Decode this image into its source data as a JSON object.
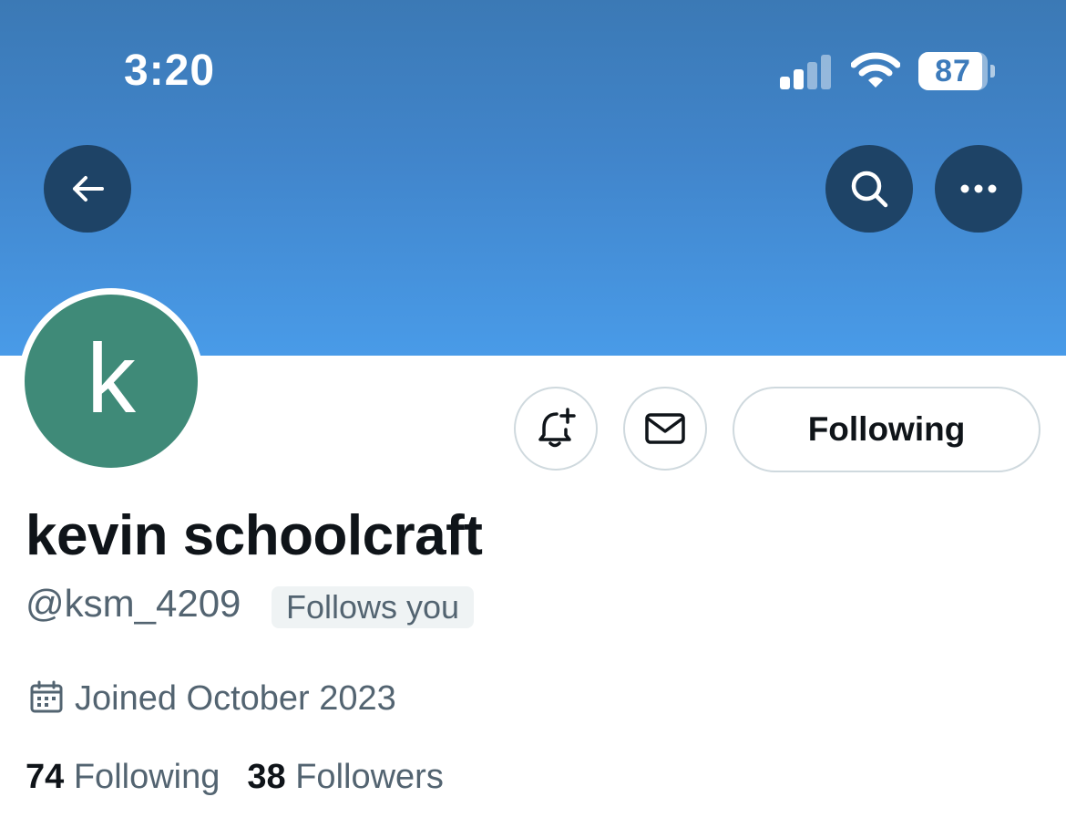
{
  "status_bar": {
    "time": "3:20",
    "battery_percent": "87",
    "signal_bars_active": 2,
    "signal_bars_total": 4
  },
  "header": {
    "banner_color": "#4185cb",
    "back_icon": "arrow-left-icon",
    "search_icon": "search-icon",
    "more_icon": "more-horizontal-icon"
  },
  "profile": {
    "avatar_letter": "k",
    "avatar_color": "#3f8a78",
    "name": "kevin schoolcraft",
    "handle": "@ksm_4209",
    "follows_you_label": "Follows you",
    "joined": "Joined October 2023",
    "following_count": "74",
    "following_label": "Following",
    "followers_count": "38",
    "followers_label": "Followers"
  },
  "actions": {
    "notify_icon": "bell-plus-icon",
    "message_icon": "envelope-icon",
    "follow_button_label": "Following"
  }
}
